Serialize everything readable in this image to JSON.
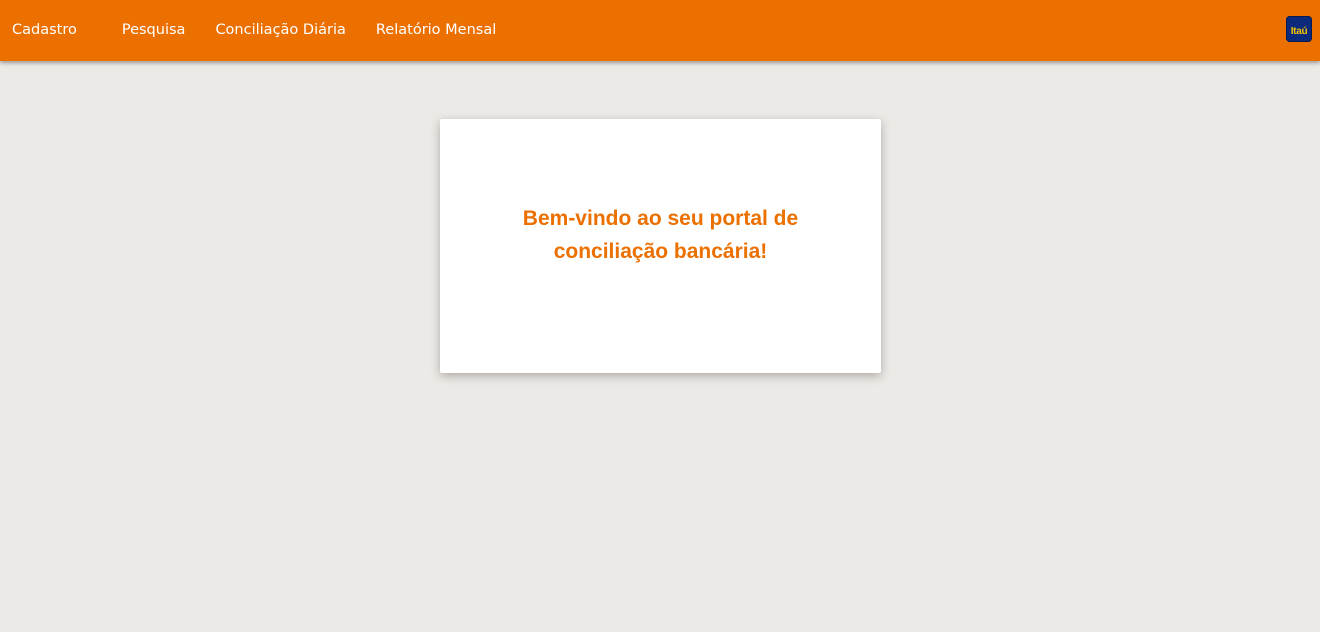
{
  "header": {
    "nav": [
      {
        "label": "Cadastro"
      },
      {
        "label": "Pesquisa"
      },
      {
        "label": "Conciliação Diária"
      },
      {
        "label": "Relatório Mensal"
      }
    ],
    "logo_text": "Itaú",
    "icon": "itau-logo-icon",
    "background_color": "#ec7000"
  },
  "main": {
    "welcome_line1": "Bem-vindo ao seu portal de",
    "welcome_line2": "conciliação bancária!",
    "accent_color": "#ec7000",
    "background_color": "#ede9e6"
  }
}
